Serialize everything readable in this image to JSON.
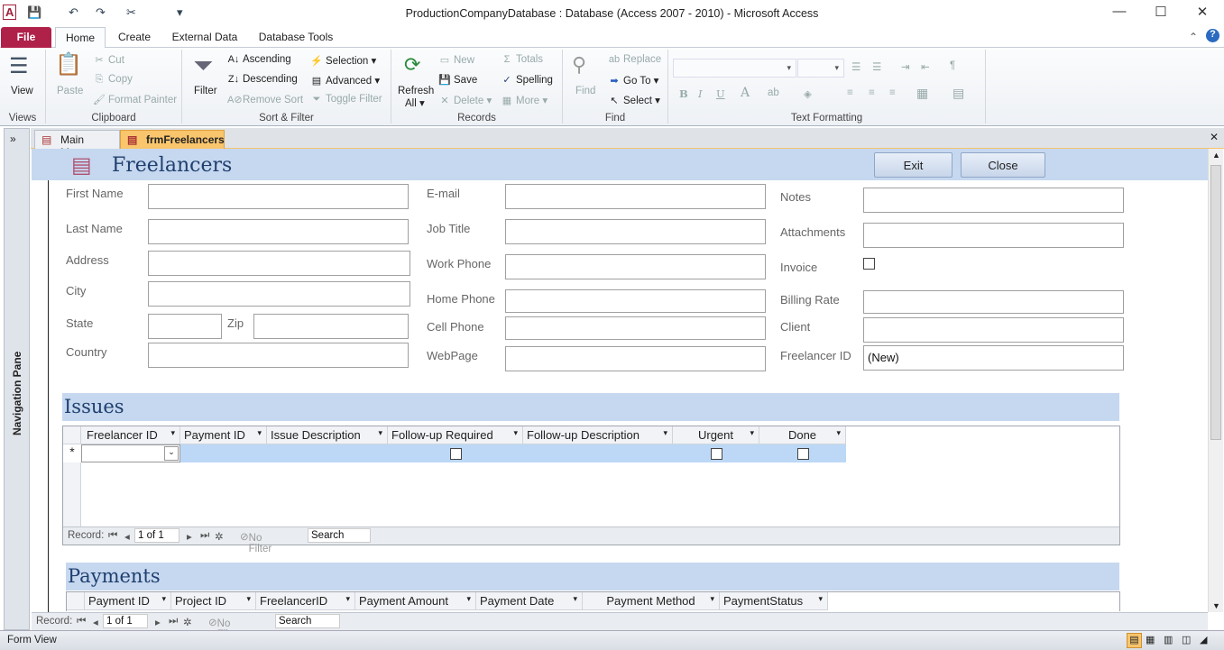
{
  "window": {
    "title": "ProductionCompanyDatabase : Database (Access 2007 - 2010)  -  Microsoft Access"
  },
  "ribbon_tabs": [
    "File",
    "Home",
    "Create",
    "External Data",
    "Database Tools"
  ],
  "ribbon": {
    "views": {
      "view": "View",
      "group": "Views"
    },
    "clipboard": {
      "paste": "Paste",
      "cut": "Cut",
      "copy": "Copy",
      "format_painter": "Format Painter",
      "group": "Clipboard"
    },
    "sort_filter": {
      "filter": "Filter",
      "ascending": "Ascending",
      "descending": "Descending",
      "remove_sort": "Remove Sort",
      "selection": "Selection",
      "advanced": "Advanced",
      "toggle_filter": "Toggle Filter",
      "group": "Sort & Filter"
    },
    "records": {
      "refresh": "Refresh",
      "refresh2": "All",
      "new": "New",
      "save": "Save",
      "delete": "Delete",
      "totals": "Totals",
      "spelling": "Spelling",
      "more": "More",
      "group": "Records"
    },
    "find": {
      "find": "Find",
      "replace": "Replace",
      "goto": "Go To",
      "select": "Select",
      "group": "Find"
    },
    "text_formatting": {
      "group": "Text Formatting",
      "bold": "B",
      "italic": "I",
      "underline": "U",
      "font_color": "A"
    }
  },
  "doc_tabs": [
    {
      "label": "Main Menu",
      "active": false
    },
    {
      "label": "frmFreelancers",
      "active": true
    }
  ],
  "nav_pane": {
    "label": "Navigation Pane"
  },
  "form": {
    "title": "Freelancers",
    "exit": "Exit",
    "close": "Close",
    "fields": {
      "first_name": "First Name",
      "last_name": "Last Name",
      "address": "Address",
      "city": "City",
      "state": "State",
      "zip": "Zip",
      "country": "Country",
      "email": "E-mail",
      "job_title": "Job Title",
      "work_phone": "Work Phone",
      "home_phone": "Home Phone",
      "cell_phone": "Cell Phone",
      "webpage": "WebPage",
      "notes": "Notes",
      "attachments": "Attachments",
      "invoice": "Invoice",
      "billing_rate": "Billing Rate",
      "client": "Client",
      "freelancer_id": "Freelancer ID",
      "freelancer_id_value": "(New)"
    }
  },
  "issues": {
    "title": "Issues",
    "columns": [
      "Freelancer ID",
      "Payment ID",
      "Issue Description",
      "Follow-up Required",
      "Follow-up Description",
      "Urgent",
      "Done"
    ],
    "new_row_marker": "*"
  },
  "payments": {
    "title": "Payments",
    "columns": [
      "Payment ID",
      "Project ID",
      "FreelancerID",
      "Payment Amount",
      "Payment Date",
      "Payment Method",
      "PaymentStatus"
    ]
  },
  "record_nav": {
    "label": "Record:",
    "position": "1 of 1",
    "filter": "No Filter",
    "search": "Search"
  },
  "status_bar": {
    "view": "Form View"
  },
  "colors": {
    "file_tab": "#b0214a",
    "section_header": "#c6d8ef",
    "active_tab": "#f7c26a"
  }
}
